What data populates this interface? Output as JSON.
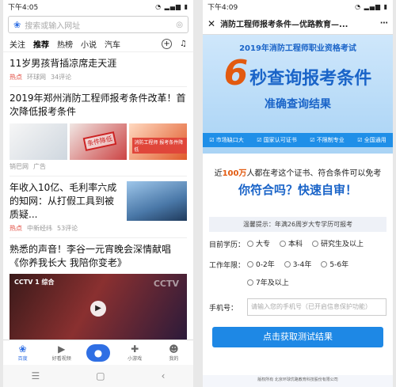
{
  "left": {
    "status": {
      "time": "下午4:05"
    },
    "search": {
      "placeholder": "搜索或输入网址"
    },
    "tabs": [
      "关注",
      "推荐",
      "热榜",
      "小说",
      "汽车"
    ],
    "active_tab": "推荐",
    "feed": [
      {
        "title": "11岁男孩背插凉席走天涯",
        "tag": "热点",
        "source": "环球网",
        "comments": "34评论"
      },
      {
        "title": "2019年郑州消防工程师报考条件改革！首次降低报考条件",
        "source": "销巴网",
        "comments": "广告",
        "stamp": "条件降低",
        "tag_small": "消防工程师 报考条件降低"
      },
      {
        "title": "年收入10亿、毛利率六成的知网：从打假工具到被质疑...",
        "tag": "热点",
        "source": "中新经纬",
        "comments": "53评论"
      },
      {
        "title": "熟悉的声音！李谷一元宵晚会深情献唱《你养我长大 我陪你变老》",
        "video_logo": "CCTV 1 综合",
        "video_logo2": "CCTV"
      }
    ],
    "bottom_nav": [
      {
        "label": "百度",
        "icon": "paw-icon"
      },
      {
        "label": "好看视频",
        "icon": "play-icon"
      },
      {
        "label": "小游戏",
        "icon": "gamepad-icon"
      },
      {
        "label": "我的",
        "icon": "user-icon"
      }
    ],
    "accent": "#2f6fe4"
  },
  "right": {
    "status": {
      "time": "下午4:09"
    },
    "title": "消防工程师报考条件—优路教育—...",
    "banner": {
      "line1": "2019年消防工程师职业资格考试",
      "six": "6",
      "slogan": "秒查询报考条件",
      "line3": "准确查询结果",
      "features": [
        "市场缺口大",
        "国家认可证书",
        "不限制专业",
        "全国通用"
      ]
    },
    "intro": {
      "pre": "近",
      "highlight": "100万",
      "post": "人都在考这个证书、符合条件可以免考",
      "question": "你符合吗？快速自审！"
    },
    "form": {
      "tip": "温馨提示：年满26周岁大专学历可报考",
      "education_label": "目前学历：",
      "education_options": [
        "大专",
        "本科",
        "研究生及以上"
      ],
      "years_label": "工作年限：",
      "years_options": [
        "0-2年",
        "3-4年",
        "5-6年",
        "7年及以上"
      ],
      "phone_label": "手机号：",
      "phone_placeholder": "请输入您的手机号（已开启信息保护功能）",
      "submit": "点击获取测试结果"
    },
    "footer": "版权所有 北京环球优路教育科技股份有限公司",
    "accent": "#1e88e5",
    "highlight_color": "#e25a10"
  }
}
